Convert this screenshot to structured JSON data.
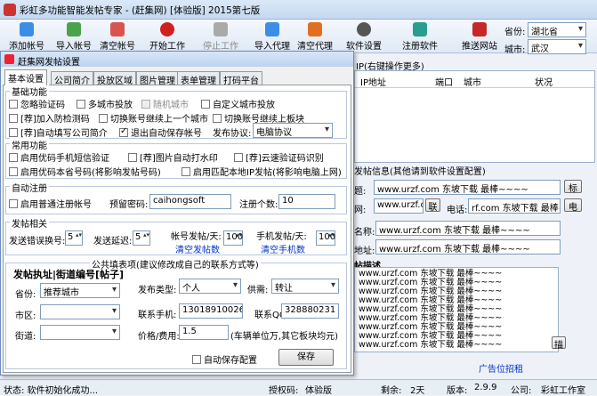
{
  "window": {
    "title": "彩虹多功能智能发帖专家 - (赶集网)    [体验版]    2015第七版"
  },
  "toolbar": {
    "buttons": [
      "添加帐号",
      "导入帐号",
      "清空帐号",
      "开始工作",
      "停止工作",
      "导入代理",
      "清空代理",
      "软件设置",
      "注册软件",
      "推送网站"
    ],
    "province_label": "省份:",
    "province_value": "湖北省",
    "city_label": "城市:",
    "city_value": "武汉"
  },
  "right": {
    "proxy_header": "IP(右键操作更多)",
    "proxy_cols": [
      "IP地址",
      "端口",
      "城市",
      "状况"
    ],
    "info_header": "发帖信息(其他请到软件设置配置)",
    "row1_label": "题:",
    "row1_value": "www.urzf.com  东坡下载  最棒~~~~",
    "row1_btn": "标",
    "row2_label": "网:",
    "row2_value": "www.urzf.c",
    "row2_btn": "联",
    "row2_phone_label": "电话:",
    "row2_phone_value": "rf.com  东坡下载  最棒~~~~",
    "row2_btn2": "电",
    "row3_label": "名称:",
    "row3_value": "www.urzf.com  东坡下载  最棒~~~~",
    "row4_label": "地址:",
    "row4_value": "www.urzf.com  东坡下载  最棒~~~~",
    "desc_label": "帖描述",
    "desc_lines": [
      "www.urzf.com  东坡下载  最棒~~~~",
      "www.urzf.com  东坡下载  最棒~~~~",
      "www.urzf.com  东坡下载  最棒~~~~",
      "www.urzf.com  东坡下载  最棒~~~~",
      "www.urzf.com  东坡下载  最棒~~~~",
      "www.urzf.com  东坡下载  最棒~~~~",
      "www.urzf.com  东坡下载  最棒~~~~",
      "www.urzf.com  东坡下载  最棒~~~~",
      "www.urzf.com  东坡下载  最棒~~~~"
    ],
    "desc_btn": "描",
    "ad_link": "广告位招租"
  },
  "status": {
    "left": "状态:  软件初始化成功...",
    "auth_label": "授权码:",
    "auth_value": "体验版",
    "remain_label": "剩余:",
    "remain_value": "2天",
    "ver_label": "版本:",
    "ver_value": "2.9.9",
    "company_label": "公司:",
    "company_value": "彩虹工作室"
  },
  "dialog": {
    "title": "赶集网发帖设置",
    "tabs": [
      "基本设置",
      "公司简介",
      "投放区域",
      "图片管理",
      "表单管理",
      "打码平台"
    ],
    "basic_title": "基础功能",
    "basic_opts": [
      "忽略验证码",
      "多城市投放",
      "随机城市",
      "自定义城市投放",
      "[荐]加入防检测码",
      "切换账号继续上一个城市",
      "切换账号继续上板块",
      "[荐]自动填写公司简介",
      "退出自动保存帐号"
    ],
    "publish_label": "发布协议:",
    "publish_value": "电脑协议",
    "common_title": "常用功能",
    "common_opts": [
      "启用优码手机短信验证",
      "[荐]图片自动打水印",
      "[荐]云速验证码识别",
      "启用优码本省号码(将影响发帖号码)",
      "启用匹配本地IP发帖(将影响电脑上网)"
    ],
    "reg_title": "自动注册",
    "reg_opt": "启用普通注册帐号",
    "pwd_label": "预留密码:",
    "pwd_value": "caihongsoft",
    "count_label": "注册个数:",
    "count_value": "10",
    "post_title": "发帖相关",
    "err_label": "发送错误换号:",
    "err_value": "5",
    "delay_label": "发送延迟:",
    "delay_value": "5",
    "acct_label": "帐号发帖/天:",
    "acct_value": "100",
    "clear_posts": "清空发帖数",
    "phone_label": "手机发帖/天:",
    "phone_value": "100",
    "clear_phone": "清空手机数",
    "public_title": "公共填表项(建议修改成自己的联系方式等)",
    "left_head": "发帖执址|街道编号[帖子]",
    "prov_label": "省份:",
    "prov_value": "推荐城市",
    "area_label": "市区:",
    "area_value": "",
    "street_label": "街道:",
    "street_value": "",
    "type_label": "发布类型:",
    "type_value": "个人",
    "supply_label": "供需:",
    "supply_value": "转让",
    "mobile_label": "联系手机:",
    "mobile_value": "13018910026",
    "qq_label": "联系QQ:",
    "qq_value": "328880231",
    "price_label": "价格/费用:",
    "price_value": "1.5",
    "price_note": "(车辆单位万,其它板块均元)",
    "autosave": "自动保存配置",
    "save": "保存"
  }
}
